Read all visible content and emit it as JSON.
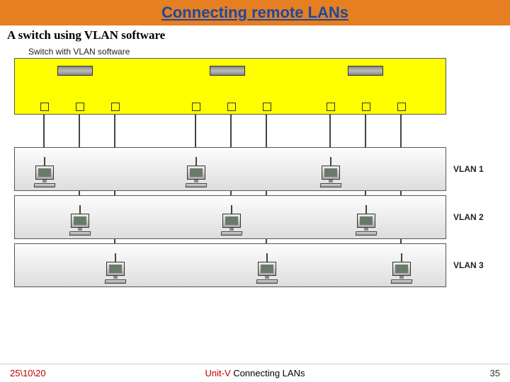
{
  "header": {
    "title": "Connecting remote LANs"
  },
  "subtitle": "A switch using VLAN software",
  "switch_label": "Switch with VLAN software",
  "vlans": {
    "v1": "VLAN 1",
    "v2": "VLAN 2",
    "v3": "VLAN 3"
  },
  "footer": {
    "date": "25\\10\\20",
    "unit": "Unit-V",
    "topic": " Connecting LANs",
    "page": "35"
  },
  "chart_data": {
    "type": "diagram",
    "title": "A switch using VLAN software",
    "switch": {
      "label": "Switch with VLAN software",
      "modules": 3,
      "ports": 9
    },
    "vlans": [
      {
        "name": "VLAN 1",
        "hosts": 3,
        "port_indices": [
          1,
          4,
          7
        ]
      },
      {
        "name": "VLAN 2",
        "hosts": 3,
        "port_indices": [
          2,
          5,
          8
        ]
      },
      {
        "name": "VLAN 3",
        "hosts": 3,
        "port_indices": [
          3,
          6,
          9
        ]
      }
    ]
  }
}
